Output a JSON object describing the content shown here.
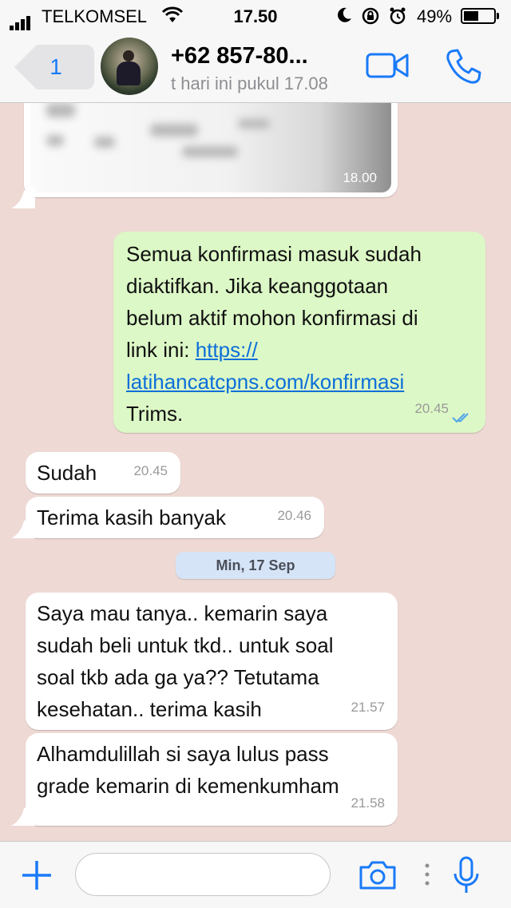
{
  "status_bar": {
    "carrier": "TELKOMSEL",
    "time": "17.50",
    "battery": "49%",
    "icons": [
      "signal-icon",
      "wifi-icon",
      "moon-icon",
      "rotation-lock-icon",
      "alarm-icon",
      "battery-icon"
    ]
  },
  "header": {
    "back_count": "1",
    "contact_name": "+62 857-80...",
    "last_seen": "t hari ini pukul 17.08",
    "icons": [
      "back-chevron-icon",
      "video-call-icon",
      "phone-call-icon"
    ]
  },
  "messages": [
    {
      "direction": "in",
      "type": "image",
      "time": "18.00"
    },
    {
      "direction": "out",
      "lines": [
        "Semua konfirmasi masuk sudah",
        "diaktifkan. Jika keanggotaan",
        "belum aktif mohon konfirmasi di",
        "link ini: "
      ],
      "link_part1": "https://",
      "link_part2": "latihancatcpns.com/konfirmasi",
      "after": "Trims.",
      "time": "20.45",
      "status": "read"
    },
    {
      "direction": "in",
      "text": "Sudah",
      "time": "20.45"
    },
    {
      "direction": "in",
      "text": "Terima kasih banyak",
      "time": "20.46"
    },
    {
      "direction": "in",
      "lines": [
        "Saya mau tanya.. kemarin saya",
        "sudah beli untuk tkd.. untuk soal",
        "soal tkb ada ga ya?? Tetutama",
        "kesehatan.. terima kasih"
      ],
      "time": "21.57"
    },
    {
      "direction": "in",
      "lines": [
        "Alhamdulillah si saya lulus pass",
        "grade kemarin di kemenkumham"
      ],
      "time": "21.58"
    }
  ],
  "date_separator": "Min, 17 Sep",
  "input_bar": {
    "placeholder": "",
    "icons": [
      "plus-icon",
      "camera-icon",
      "more-dots-icon",
      "microphone-icon"
    ]
  },
  "colors": {
    "accent": "#1a7af8",
    "outgoing": "#dcf8c6",
    "incoming": "#ffffff",
    "background": "#eed9d4"
  }
}
